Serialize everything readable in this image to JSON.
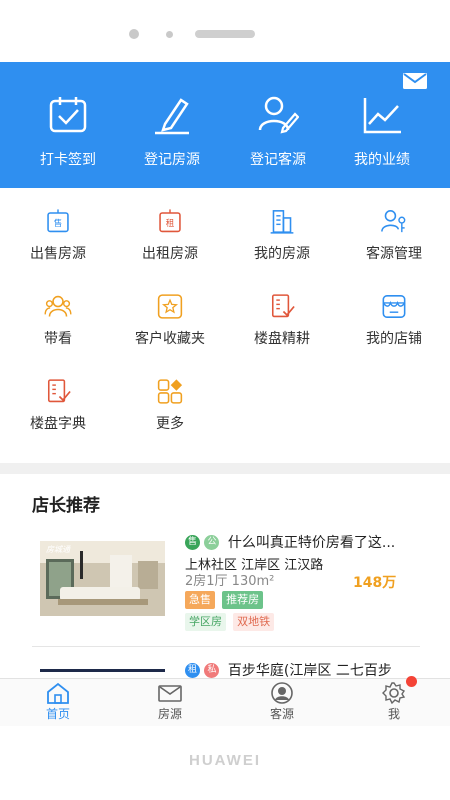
{
  "device": {
    "brand": "HUAWEI"
  },
  "colors": {
    "primary": "#2f8ff0",
    "price": "#f0a020",
    "notification": "#f44336"
  },
  "header": {
    "mail_icon": "mail-icon",
    "actions": [
      {
        "label": "打卡签到",
        "icon": "calendar-check-icon"
      },
      {
        "label": "登记房源",
        "icon": "pen-icon"
      },
      {
        "label": "登记客源",
        "icon": "user-edit-icon"
      },
      {
        "label": "我的业绩",
        "icon": "line-chart-icon"
      }
    ]
  },
  "menu": {
    "items": [
      {
        "label": "出售房源",
        "icon": "sale-sign-icon",
        "sign": "售"
      },
      {
        "label": "出租房源",
        "icon": "rent-sign-icon",
        "sign": "租"
      },
      {
        "label": "我的房源",
        "icon": "buildings-icon"
      },
      {
        "label": "客源管理",
        "icon": "user-key-icon"
      },
      {
        "label": "带看",
        "icon": "group-icon"
      },
      {
        "label": "客户收藏夹",
        "icon": "star-box-icon"
      },
      {
        "label": "楼盘精耕",
        "icon": "building-check-icon"
      },
      {
        "label": "我的店铺",
        "icon": "store-icon"
      },
      {
        "label": "楼盘字典",
        "icon": "dictionary-icon"
      },
      {
        "label": "更多",
        "icon": "more-grid-icon"
      }
    ]
  },
  "recommend": {
    "title": "店长推荐",
    "listings": [
      {
        "badges": [
          "售",
          "公"
        ],
        "title": "什么叫真正特价房看了这...",
        "address": "上林社区 江岸区 江汉路",
        "spec": "2房1厅 130m²",
        "price": "148万",
        "tags_row1": [
          "急售",
          "推荐房"
        ],
        "tags_row2": [
          "学区房",
          "双地铁"
        ]
      },
      {
        "badges": [
          "租",
          "私"
        ],
        "title": "百步华庭(江岸区 二七百步"
      }
    ]
  },
  "tabbar": {
    "tabs": [
      {
        "label": "首页",
        "icon": "home-icon",
        "active": true
      },
      {
        "label": "房源",
        "icon": "envelope-icon",
        "active": false
      },
      {
        "label": "客源",
        "icon": "person-icon",
        "active": false
      },
      {
        "label": "我",
        "icon": "gear-icon",
        "active": false
      }
    ]
  }
}
